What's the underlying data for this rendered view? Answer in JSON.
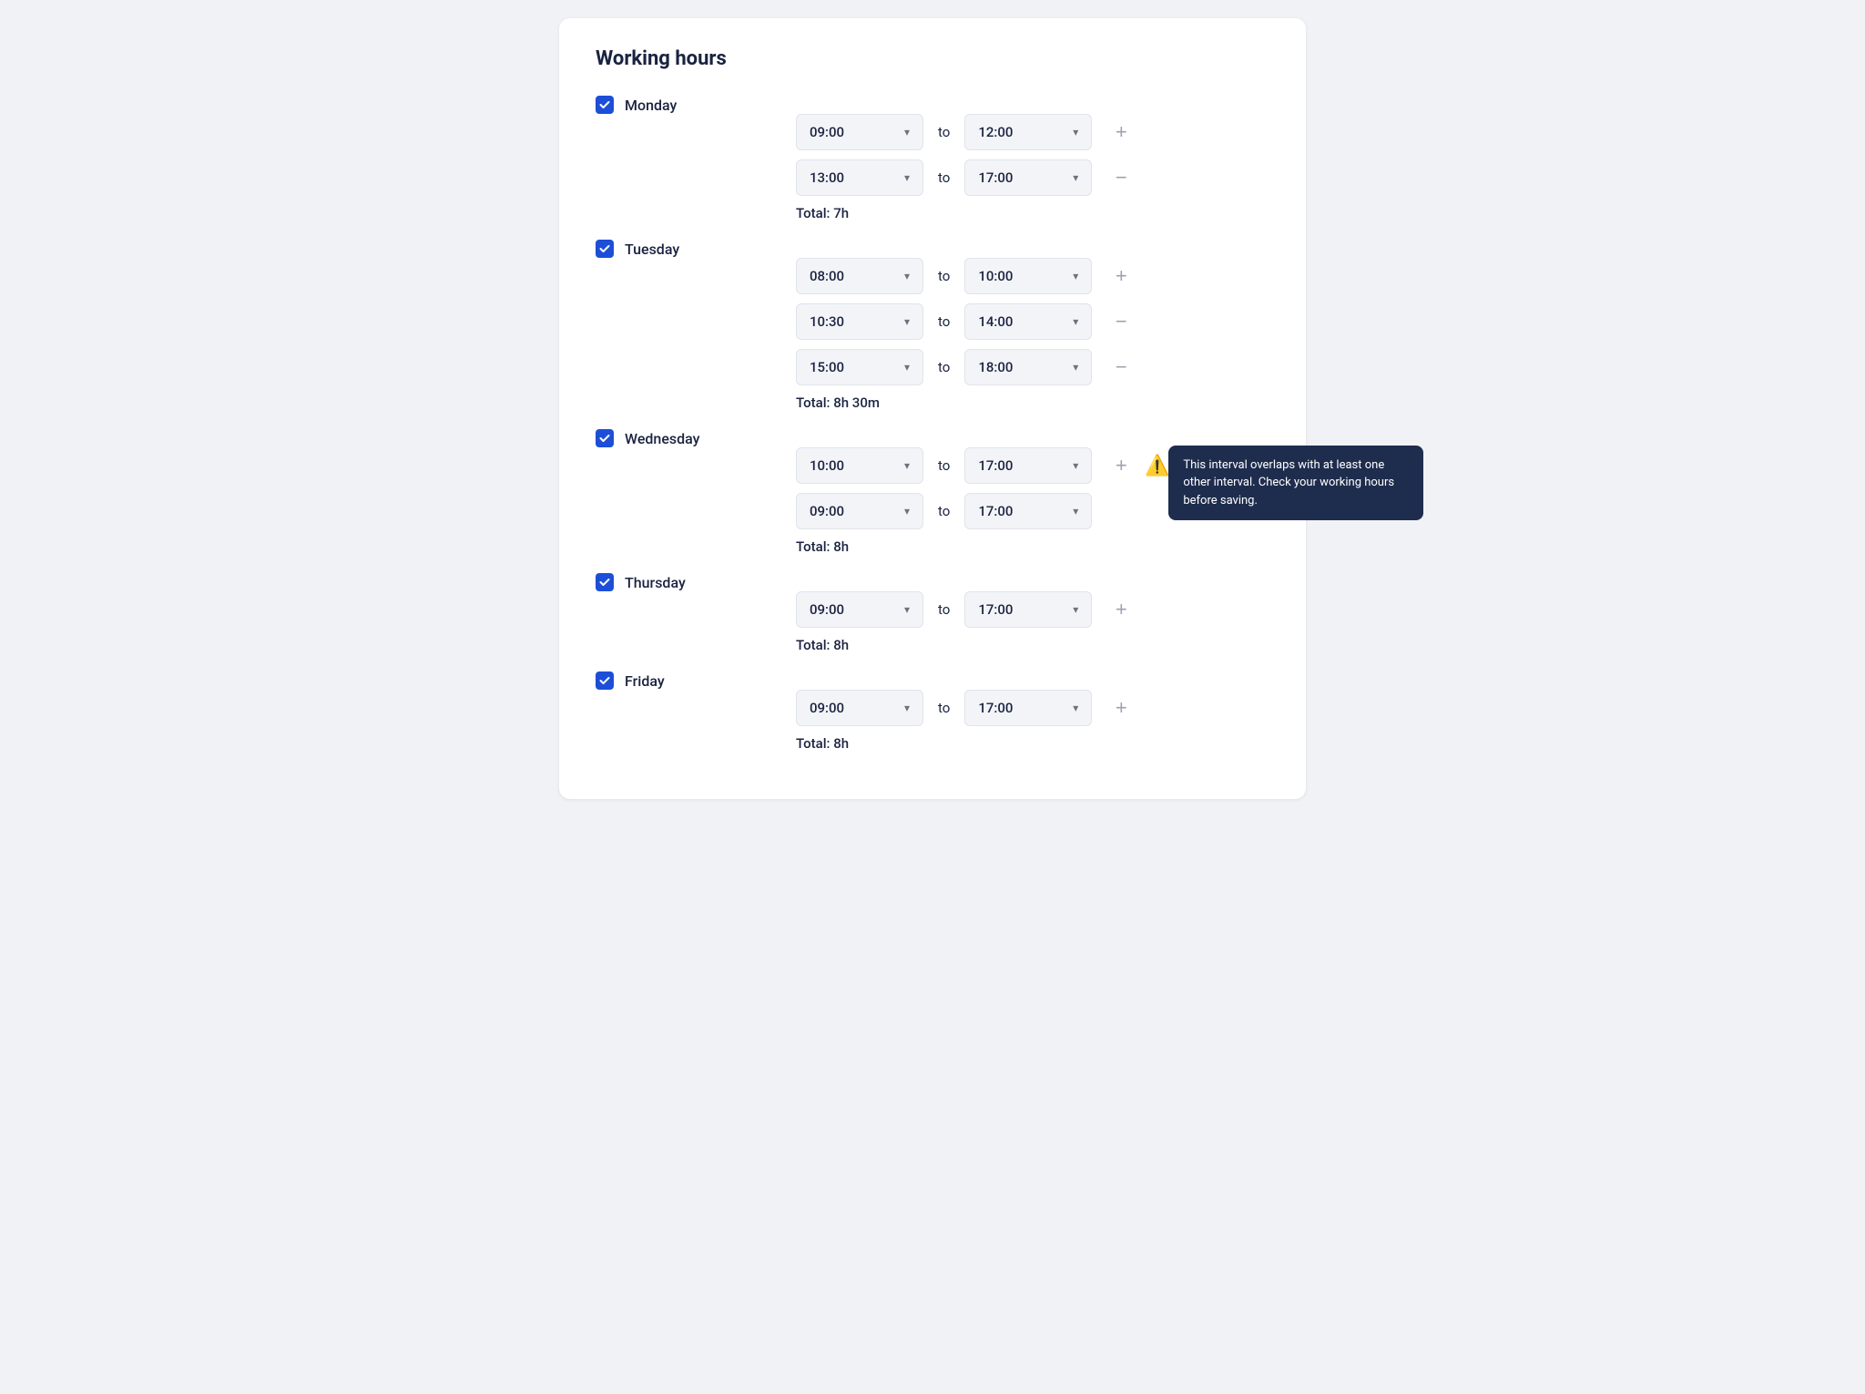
{
  "page": {
    "title": "Working hours"
  },
  "days": [
    {
      "id": "monday",
      "name": "Monday",
      "checked": true,
      "intervals": [
        {
          "from": "09:00",
          "to": "12:00",
          "action": "add",
          "warning": false
        },
        {
          "from": "13:00",
          "to": "17:00",
          "action": "remove",
          "warning": false
        }
      ],
      "total": "Total: 7h"
    },
    {
      "id": "tuesday",
      "name": "Tuesday",
      "checked": true,
      "intervals": [
        {
          "from": "08:00",
          "to": "10:00",
          "action": "add",
          "warning": false
        },
        {
          "from": "10:30",
          "to": "14:00",
          "action": "remove",
          "warning": false
        },
        {
          "from": "15:00",
          "to": "18:00",
          "action": "remove",
          "warning": false
        }
      ],
      "total": "Total: 8h 30m"
    },
    {
      "id": "wednesday",
      "name": "Wednesday",
      "checked": true,
      "intervals": [
        {
          "from": "10:00",
          "to": "17:00",
          "action": "add",
          "warning": true,
          "tooltip": "This interval overlaps with at least one other interval. Check your working hours before saving."
        },
        {
          "from": "09:00",
          "to": "17:00",
          "action": "none",
          "warning": false
        }
      ],
      "total": "Total: 8h"
    },
    {
      "id": "thursday",
      "name": "Thursday",
      "checked": true,
      "intervals": [
        {
          "from": "09:00",
          "to": "17:00",
          "action": "add",
          "warning": false
        }
      ],
      "total": "Total: 8h"
    },
    {
      "id": "friday",
      "name": "Friday",
      "checked": true,
      "intervals": [
        {
          "from": "09:00",
          "to": "17:00",
          "action": "add",
          "warning": false
        }
      ],
      "total": "Total: 8h"
    }
  ],
  "labels": {
    "to": "to",
    "add": "+",
    "remove": "−"
  }
}
